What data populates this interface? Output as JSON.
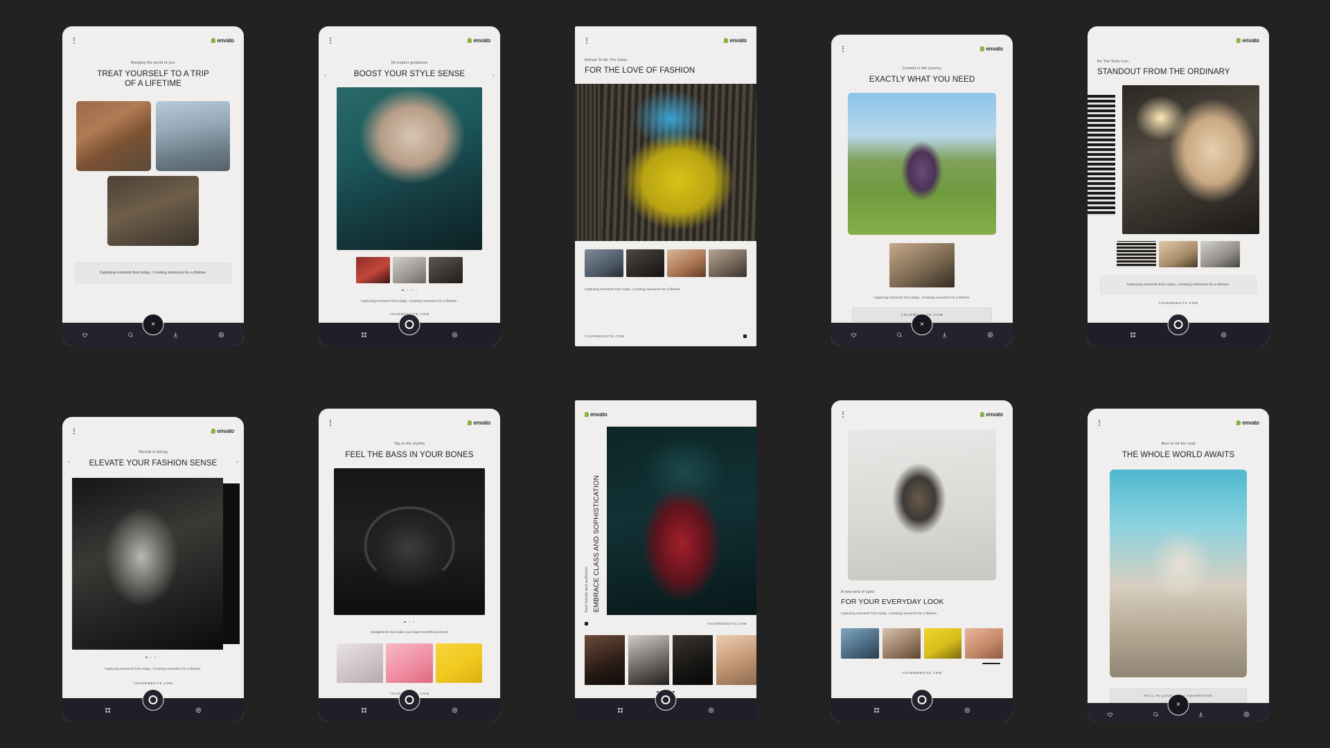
{
  "meta": {
    "background_color": "#222223",
    "phone_bg": "#f0efee",
    "navbar_color": "#22232d",
    "brand_green": "#81b441"
  },
  "brand": {
    "name": "envato",
    "icon": "envato-leaf-icon"
  },
  "common": {
    "body_copy": "Capturing moments from today...Creating memories for a lifetime.",
    "weblink": "YOURWEBSITE.COM",
    "nav_icons": [
      "heart-icon",
      "search-icon",
      "download-icon",
      "settings-icon"
    ],
    "nav_icons_alt": [
      "grid-icon",
      "settings-icon"
    ],
    "fab_label": "×"
  },
  "phones": [
    {
      "id": "phone-1",
      "eyebrow": "Bringing the world to you",
      "headline": "TREAT YOURSELF TO A TRIP OF A LIFETIME",
      "align": "center",
      "body_copy": "Capturing moments from today...Creating memories for a lifetime.",
      "cta": "",
      "weblink": "",
      "nav_style": "four-icons-fab-x",
      "frame": "round"
    },
    {
      "id": "phone-2",
      "eyebrow": "Do expect greatness",
      "headline": "BOOST YOUR STYLE SENSE",
      "align": "center",
      "body_copy": "Capturing moments from today...Creating memories for a lifetime.",
      "cta": "",
      "weblink": "YOURWEBSITE.COM",
      "nav_style": "two-icons-fab-ring",
      "frame": "round",
      "has_plus": true,
      "pager": {
        "count": 4,
        "active": 1
      }
    },
    {
      "id": "phone-3",
      "eyebrow": "Refuse To Be The Same",
      "headline": "FOR THE LOVE OF FASHION",
      "align": "left",
      "body_copy": "Capturing moments from today...Creating memories for a lifetime.",
      "cta": "",
      "weblink": "YOURWEBSITE.COM",
      "nav_style": "none",
      "frame": "square"
    },
    {
      "id": "phone-4",
      "eyebrow": "Commit to the journey",
      "headline": "EXACTLY WHAT YOU NEED",
      "align": "center",
      "body_copy": "Capturing moments from today...Creating memories for a lifetime.",
      "cta": "YOURWEBSITE.COM",
      "weblink": "",
      "nav_style": "four-icons-fab-x",
      "frame": "round"
    },
    {
      "id": "phone-5",
      "eyebrow": "Be The Style Icon",
      "headline": "STANDOUT FROM THE ORDINARY",
      "align": "left",
      "body_copy": "Capturing moments from today...Creating memories for a lifetime.",
      "cta": "",
      "weblink": "YOURWEBSITE.COM",
      "nav_style": "two-icons-fab-ring",
      "frame": "round"
    },
    {
      "id": "phone-6",
      "eyebrow": "Normal is boring",
      "headline": "ELEVATE YOUR FASHION SENSE",
      "align": "center",
      "body_copy": "Capturing moments from today...Creating memories for a lifetime.",
      "cta": "",
      "weblink": "YOURWEBSITE.COM",
      "nav_style": "two-icons-fab-ring",
      "frame": "round",
      "has_plus": true,
      "pager": {
        "count": 4,
        "active": 1
      }
    },
    {
      "id": "phone-7",
      "eyebrow": "Tap to the rhythm",
      "headline": "FEEL THE BASS IN YOUR BONES",
      "align": "center",
      "body_copy": "Headphones that make you forget everything around",
      "cta": "",
      "weblink": "YOURWEBSITE.COM",
      "nav_style": "two-icons-fab-ring",
      "frame": "round",
      "pager": {
        "count": 3,
        "active": 0
      }
    },
    {
      "id": "phone-8",
      "eyebrow": "Feel trendy and authentic",
      "headline": "EMBRACE CLASS AND SOPHISTICATION",
      "align": "vertical",
      "body_copy": "",
      "cta": "",
      "weblink": "YOURWEBSITE.COM",
      "nav_style": "two-icons-fab-ring",
      "frame": "square"
    },
    {
      "id": "phone-9",
      "eyebrow": "A new kind of spirit",
      "headline": "FOR YOUR EVERYDAY LOOK",
      "align": "left",
      "body_copy": "Capturing moments from today...Creating memories for a lifetime.",
      "cta": "",
      "weblink": "YOURWEBSITE.COM",
      "nav_style": "two-icons-fab-ring",
      "frame": "round"
    },
    {
      "id": "phone-10",
      "eyebrow": "Born to hit the road",
      "headline": "THE WHOLE WORLD AWAITS",
      "align": "center",
      "body_copy": "",
      "cta": "FALL IN LOVE WITH ADVENTURE",
      "weblink": "",
      "nav_style": "four-icons-fab-x",
      "frame": "round"
    }
  ]
}
